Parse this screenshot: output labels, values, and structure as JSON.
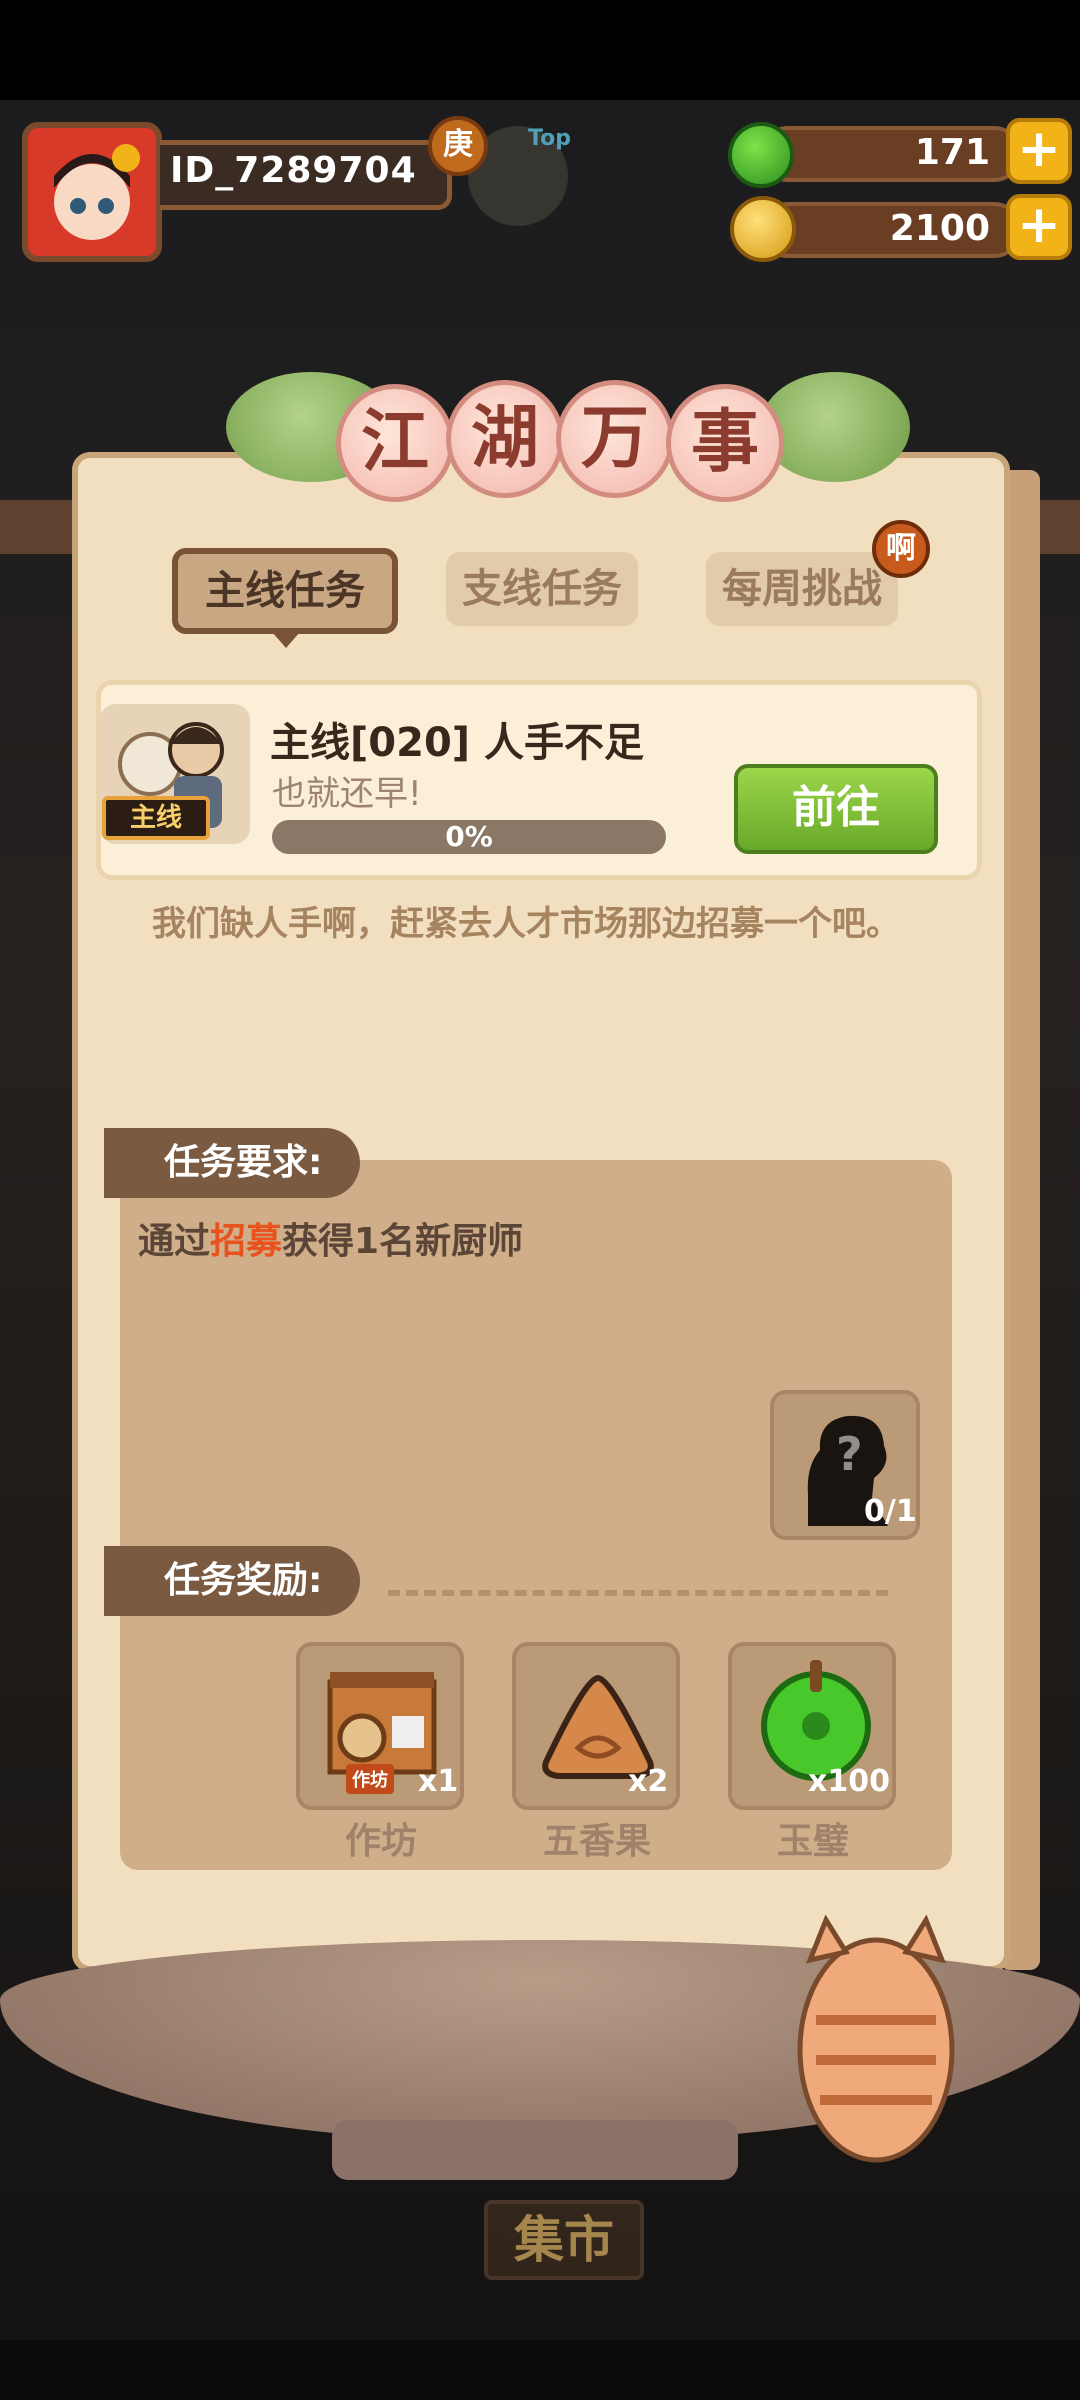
{
  "player": {
    "id": "ID_7289704",
    "rank_badge": "庚",
    "top_label": "Top"
  },
  "currency": {
    "jade": "171",
    "coins": "2100"
  },
  "panel": {
    "title_chars": [
      "江",
      "湖",
      "万",
      "事"
    ],
    "tabs": [
      "主线任务",
      "支线任务",
      "每周挑战"
    ],
    "tab_badge": "啊"
  },
  "quest": {
    "tag": "主线",
    "title": "主线[020] 人手不足",
    "subtitle": "也就还早!",
    "progress_text": "0%",
    "progress_value": 0,
    "go_label": "前往",
    "description": "我们缺人手啊，赶紧去人才市场那边招募一个吧。"
  },
  "requirement": {
    "header": "任务要求:",
    "text_before": "通过",
    "text_highlight": "招募",
    "text_after": "获得1名新厨师",
    "count": "0/1"
  },
  "rewards": {
    "header": "任务奖励:",
    "items": [
      {
        "name": "作坊",
        "qty": "x1",
        "tag": "作坊"
      },
      {
        "name": "五香果",
        "qty": "x2"
      },
      {
        "name": "玉璧",
        "qty": "x100"
      }
    ]
  },
  "bottom": {
    "market": "集市"
  },
  "colors": {
    "accent_green": "#6cc23e",
    "highlight": "#e8521d",
    "panel": "#f1dfc0"
  }
}
